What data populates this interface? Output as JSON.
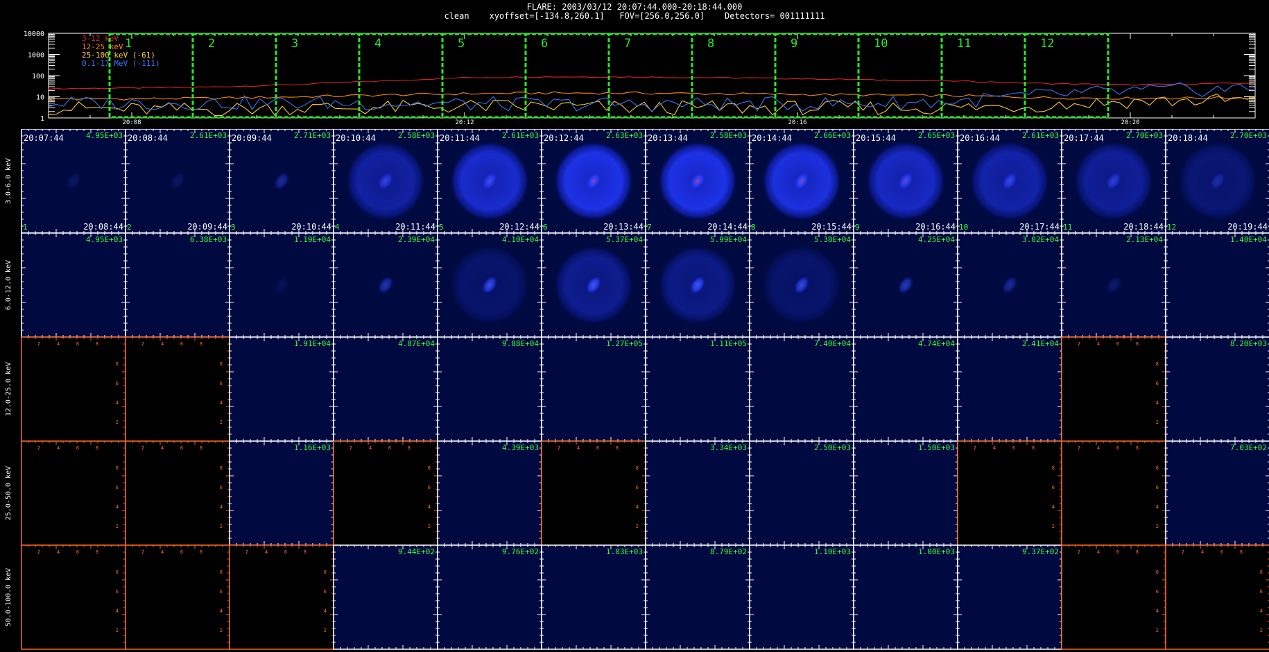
{
  "header": {
    "line1": "FLARE: 2003/03/12 20:07:44.000-20:18:44.000",
    "line2": "clean    xyoffset=[-134.8,260.1]   FOV=[256.0,256.0]    Detectors= 001111111"
  },
  "chart_data": [
    {
      "type": "line",
      "yscale": "log",
      "ylim": [
        1,
        10000
      ],
      "ytick_labels": [
        "10000",
        "1000",
        "100",
        "10",
        "1"
      ],
      "xtick_labels": [
        "20:08",
        "20:12",
        "20:16",
        "20:20"
      ],
      "xlim": [
        "20:07:00",
        "20:21:30"
      ],
      "legend_position": "top-left",
      "series": [
        {
          "name": "3-12 keV",
          "color": "#dd2222",
          "t": [
            "20:07:00",
            "20:08:00",
            "20:09:00",
            "20:10:00",
            "20:11:00",
            "20:12:00",
            "20:13:00",
            "20:14:00",
            "20:15:00",
            "20:16:00",
            "20:17:00",
            "20:18:00",
            "20:19:00",
            "20:20:00",
            "20:21:30"
          ],
          "values": [
            24,
            26,
            29,
            38,
            55,
            80,
            88,
            86,
            80,
            72,
            62,
            54,
            42,
            36,
            45
          ]
        },
        {
          "name": "12-25 keV",
          "color": "#ff8800",
          "t": [
            "20:07:00",
            "20:08:00",
            "20:09:00",
            "20:10:00",
            "20:11:00",
            "20:12:00",
            "20:13:00",
            "20:14:00",
            "20:15:00",
            "20:16:00",
            "20:17:00",
            "20:18:00",
            "20:19:00",
            "20:20:00",
            "20:21:30"
          ],
          "values": [
            8,
            8,
            8.5,
            10,
            12,
            14,
            15,
            15,
            14,
            13,
            12,
            11,
            9,
            8.5,
            9
          ]
        },
        {
          "name": "25-100 keV (-61)",
          "color": "#ffcc22",
          "t": [
            "20:07:00",
            "20:08:00",
            "20:09:00",
            "20:10:00",
            "20:11:00",
            "20:12:00",
            "20:13:00",
            "20:14:00",
            "20:15:00",
            "20:16:00",
            "20:17:00",
            "20:18:00",
            "20:19:00",
            "20:20:00",
            "20:21:30"
          ],
          "values": [
            3,
            2.5,
            2.5,
            3,
            3,
            3.5,
            3.5,
            3,
            3,
            3,
            3,
            3,
            4,
            6,
            7
          ]
        },
        {
          "name": "0.1-17 MeV (-111)",
          "color": "#3377ff",
          "t": [
            "20:07:00",
            "20:08:00",
            "20:09:00",
            "20:10:00",
            "20:11:00",
            "20:12:00",
            "20:13:00",
            "20:14:00",
            "20:15:00",
            "20:16:00",
            "20:17:00",
            "20:18:00",
            "20:19:00",
            "20:20:00",
            "20:21:30"
          ],
          "values": [
            5,
            5,
            5,
            5,
            5,
            4.5,
            4.5,
            4.5,
            4.5,
            4.5,
            5,
            6,
            12,
            18,
            25
          ]
        }
      ],
      "intervals": [
        {
          "label": "1",
          "start": "20:07:44",
          "end": "20:08:44"
        },
        {
          "label": "2",
          "start": "20:08:44",
          "end": "20:09:44"
        },
        {
          "label": "3",
          "start": "20:09:44",
          "end": "20:10:44"
        },
        {
          "label": "4",
          "start": "20:10:44",
          "end": "20:11:44"
        },
        {
          "label": "5",
          "start": "20:11:44",
          "end": "20:12:44"
        },
        {
          "label": "6",
          "start": "20:12:44",
          "end": "20:13:44"
        },
        {
          "label": "7",
          "start": "20:13:44",
          "end": "20:14:44"
        },
        {
          "label": "8",
          "start": "20:14:44",
          "end": "20:15:44"
        },
        {
          "label": "9",
          "start": "20:15:44",
          "end": "20:16:44"
        },
        {
          "label": "10",
          "start": "20:16:44",
          "end": "20:17:44"
        },
        {
          "label": "11",
          "start": "20:17:44",
          "end": "20:18:44"
        },
        {
          "label": "12",
          "start": "20:18:44",
          "end": "20:19:44"
        }
      ],
      "interval_color": "#22ee22"
    },
    {
      "type": "heatmap",
      "columns": [
        {
          "start": "20:07:44",
          "end": "20:08:44",
          "num": "1"
        },
        {
          "start": "20:08:44",
          "end": "20:09:44",
          "num": "2"
        },
        {
          "start": "20:09:44",
          "end": "20:10:44",
          "num": "3"
        },
        {
          "start": "20:10:44",
          "end": "20:11:44",
          "num": "4"
        },
        {
          "start": "20:11:44",
          "end": "20:12:44",
          "num": "5"
        },
        {
          "start": "20:12:44",
          "end": "20:13:44",
          "num": "6"
        },
        {
          "start": "20:13:44",
          "end": "20:14:44",
          "num": "7"
        },
        {
          "start": "20:14:44",
          "end": "20:15:44",
          "num": "8"
        },
        {
          "start": "20:15:44",
          "end": "20:16:44",
          "num": "9"
        },
        {
          "start": "20:16:44",
          "end": "20:17:44",
          "num": "10"
        },
        {
          "start": "20:17:44",
          "end": "20:18:44",
          "num": "11"
        },
        {
          "start": "20:18:44",
          "end": "20:19:44",
          "num": "12"
        }
      ],
      "rows": [
        {
          "label": "3.0-6.0 keV",
          "peaks": [
            "4.95E+03",
            "2.61E+03",
            "2.71E+03",
            "2.58E+03",
            "2.61E+03",
            "2.63E+03",
            "2.58E+03",
            "2.66E+03",
            "2.65E+03",
            "2.61E+03",
            "2.70E+03",
            "2.70E+03"
          ],
          "ring": [
            0,
            0,
            0,
            0.55,
            0.8,
            0.95,
            0.95,
            0.9,
            0.75,
            0.6,
            0.5,
            0.3
          ],
          "core": [
            0.15,
            0.15,
            0.4,
            0.6,
            0.7,
            0.8,
            0.85,
            0.85,
            0.75,
            0.65,
            0.55,
            0.35
          ],
          "hot": [
            0,
            0,
            0,
            0,
            0,
            0.5,
            0.8,
            0.5,
            0.3,
            0,
            0,
            0
          ]
        },
        {
          "label": "6.0-12.0 keV",
          "peaks": [
            "4.95E+03",
            "6.38E+03",
            "1.19E+04",
            "2.39E+04",
            "4.10E+04",
            "5.37E+04",
            "5.99E+04",
            "5.38E+04",
            "4.25E+04",
            "3.02E+04",
            "2.13E+04",
            "1.40E+04"
          ],
          "ring": [
            0,
            0,
            0,
            0,
            0.25,
            0.45,
            0.4,
            0.25,
            0,
            0,
            0,
            0
          ],
          "core": [
            0,
            0,
            0.1,
            0.5,
            0.75,
            0.85,
            0.85,
            0.7,
            0.55,
            0.4,
            0.2,
            0
          ],
          "hot": [
            0,
            0,
            0,
            0,
            0,
            0,
            0,
            0,
            0,
            0,
            0,
            0
          ]
        },
        {
          "label": "12.0-25.0 keV",
          "peaks": [
            "",
            "",
            "1.91E+04",
            "4.87E+04",
            "9.88E+04",
            "1.27E+05",
            "1.11E+05",
            "7.40E+04",
            "4.74E+04",
            "2.41E+04",
            "",
            "8.20E+03"
          ],
          "ring": [
            0,
            0,
            0,
            0,
            0,
            0,
            0,
            0,
            0,
            0,
            0,
            0
          ],
          "core": [
            0,
            0,
            0,
            0,
            0,
            0,
            0,
            0,
            0,
            0,
            0,
            0
          ],
          "hot": [
            0,
            0,
            0,
            0,
            0,
            0,
            0,
            0,
            0,
            0,
            0,
            0
          ]
        },
        {
          "label": "25.0-50.0 keV",
          "peaks": [
            "",
            "",
            "1.16E+03",
            "",
            "4.39E+03",
            "",
            "3.34E+03",
            "2.50E+03",
            "1.50E+03",
            "",
            "",
            "7.03E+02"
          ],
          "ring": [
            0,
            0,
            0,
            0,
            0,
            0,
            0,
            0,
            0,
            0,
            0,
            0
          ],
          "core": [
            0,
            0,
            0,
            0,
            0,
            0,
            0,
            0,
            0,
            0,
            0,
            0
          ],
          "hot": [
            0,
            0,
            0,
            0,
            0,
            0,
            0,
            0,
            0,
            0,
            0,
            0
          ]
        },
        {
          "label": "50.0-100.0 keV",
          "peaks": [
            "",
            "",
            "",
            "9.44E+02",
            "9.76E+02",
            "1.03E+03",
            "8.79E+02",
            "1.10E+03",
            "1.00E+03",
            "9.37E+02",
            "",
            ""
          ],
          "ring": [
            0,
            0,
            0,
            0,
            0,
            0,
            0,
            0,
            0,
            0,
            0,
            0
          ],
          "core": [
            0,
            0,
            0,
            0,
            0,
            0,
            0,
            0,
            0,
            0,
            0,
            0
          ],
          "hot": [
            0,
            0,
            0,
            0,
            0,
            0,
            0,
            0,
            0,
            0,
            0,
            0
          ]
        }
      ],
      "empty_tick_labels": [
        "2",
        "4",
        "6",
        "8"
      ],
      "peak_color": "#33ff33",
      "empty_frame_color": "#ff6622"
    }
  ]
}
